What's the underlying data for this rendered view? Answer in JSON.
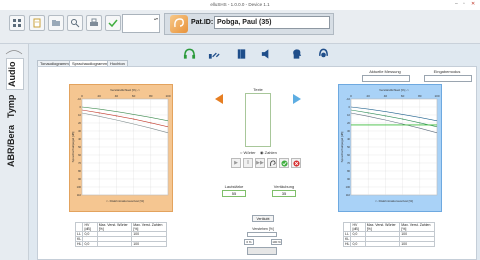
{
  "window": {
    "title": "elluSHS - 1.0.0.0 - Device 1.1"
  },
  "patient": {
    "label": "Pat.ID:",
    "name": "Pobga, Paul (35)"
  },
  "left_tabs": [
    {
      "label": "Audio"
    },
    {
      "label": "Tymp"
    },
    {
      "label": "ABR/Bera"
    }
  ],
  "subtabs": [
    {
      "label": "Tonaudiogramm"
    },
    {
      "label": "Sprachaudiogramm"
    },
    {
      "label": "Hochton"
    }
  ],
  "header": {
    "left_label": "Aktuelle Messung",
    "right_label": "Eingabemodus"
  },
  "middle": {
    "text_label": "Texte",
    "radio_left": "Wörter",
    "radio_right": "Zahlen",
    "level_label": "Lautstärke",
    "level_value": "55",
    "masking_label": "Vertäubung",
    "masking_value": "35",
    "bottom_button": "Vertäubt",
    "result_label": "Verstehen [%]",
    "stepper_left": "0 %",
    "stepper_right": "100 %"
  },
  "chart_left": {
    "top_label": "Verständlichkeit [%] ->",
    "left_label": "Sprachschallpegel [dB]",
    "bottom_label": "<- Diskriminationsverlust [%]",
    "xticks": [
      "0",
      "20",
      "40",
      "60",
      "80",
      "100"
    ],
    "yticks": [
      "-10",
      "0",
      "10",
      "20",
      "30",
      "40",
      "50",
      "60",
      "70",
      "80",
      "90",
      "100",
      "110"
    ]
  },
  "chart_right": {
    "top_label": "Verständlichkeit [%] ->",
    "left_label": "Sprachschallpegel [dB]",
    "bottom_label": "<- Diskriminationsverlust [%]",
    "xticks": [
      "0",
      "20",
      "40",
      "60",
      "80",
      "100"
    ],
    "yticks": [
      "-10",
      "0",
      "10",
      "20",
      "30",
      "40",
      "50",
      "60",
      "70",
      "80",
      "90",
      "100",
      "110"
    ]
  },
  "table_left": {
    "headers": [
      "",
      "HV [dB]",
      "Max. Verst. Wörter [%]",
      "Max. Verst. Zahlen [%]"
    ],
    "rows": [
      [
        "LL",
        "0,0",
        "",
        "100"
      ],
      [
        "KL",
        "",
        "",
        ""
      ],
      [
        "HL",
        "0,0",
        "",
        "100"
      ]
    ]
  },
  "table_right": {
    "headers": [
      "",
      "HV [dB]",
      "Max. Verst. Wörter [%]",
      "Max. Verst. Zahlen [%]"
    ],
    "rows": [
      [
        "LL",
        "0,0",
        "",
        "100"
      ],
      [
        "KL",
        "",
        "",
        ""
      ],
      [
        "HL",
        "0,0",
        "",
        "100"
      ]
    ]
  },
  "colors": {
    "left_panel": "#f5c691",
    "right_panel": "#a9d2f7",
    "toolbar": "#e9edf1"
  }
}
